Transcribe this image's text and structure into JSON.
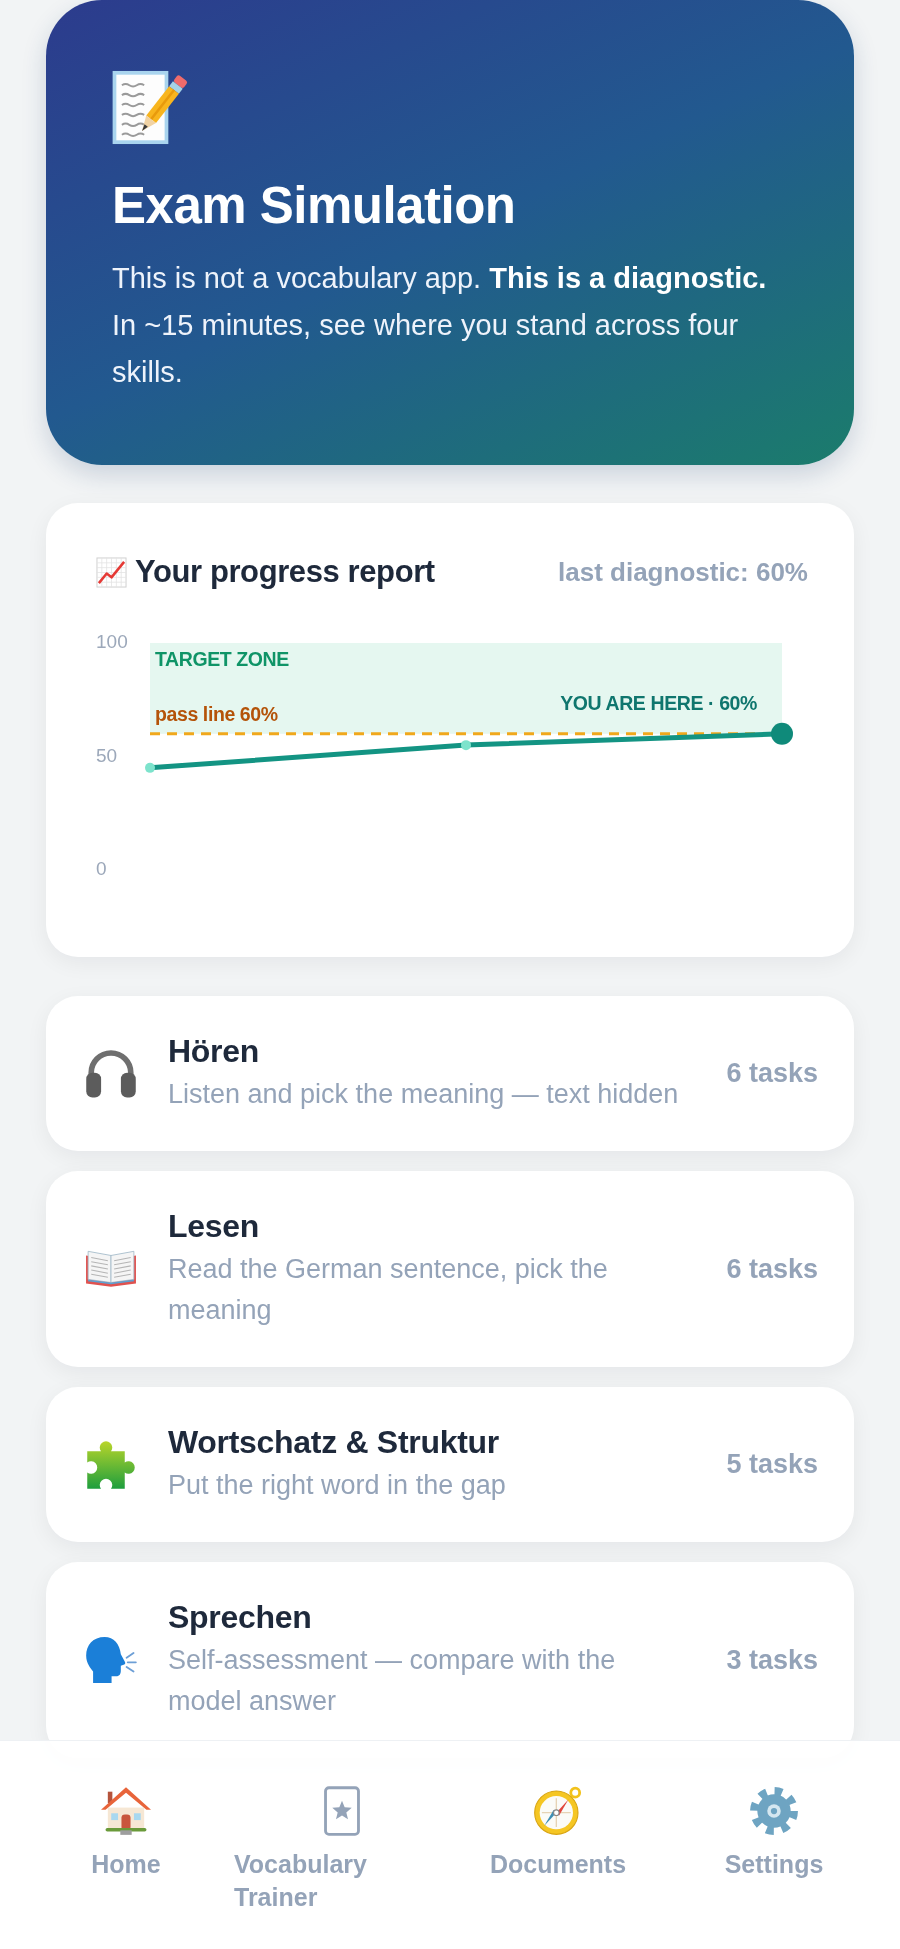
{
  "hero": {
    "title": "Exam Simulation",
    "text": "This is not a vocabulary app. **This is a diagnostic.** In ~15 minutes, see where you stand across four skills."
  },
  "progress_report": {
    "title": "Your progress report",
    "last_result": "last diagnostic: 60%",
    "chart_data": {
      "type": "line",
      "values": [
        45,
        55,
        60
      ],
      "marker": "o",
      "ylim": [
        0,
        100
      ],
      "yticks": [
        0,
        50,
        100
      ],
      "bands": [
        {
          "axis": "y",
          "from": 60,
          "to": 100,
          "label": "TARGET ZONE"
        }
      ],
      "ref_lines": [
        {
          "axis": "y",
          "value": 60,
          "label": "pass line 60%"
        }
      ],
      "annotations": [
        {
          "text": "YOU ARE HERE · 60%",
          "y": 60
        }
      ]
    }
  },
  "skills": [
    {
      "name": "Hören",
      "description": "Listen and pick the meaning — text hidden",
      "tasks": "6 tasks"
    },
    {
      "name": "Lesen",
      "description": "Read the German sentence, pick the meaning",
      "tasks": "6 tasks"
    },
    {
      "name": "Wortschatz & Struktur",
      "description": "Put the right word in the gap",
      "tasks": "5 tasks"
    },
    {
      "name": "Sprechen",
      "description": "Self-assessment — compare with the model answer",
      "tasks": "3 tasks"
    }
  ],
  "bottom_nav": [
    "Home",
    "Vocabulary Trainer",
    "Documents",
    "Settings"
  ]
}
